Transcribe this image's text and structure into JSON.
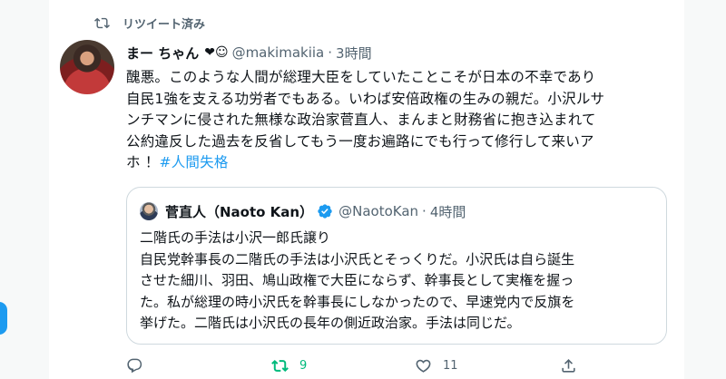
{
  "colors": {
    "accent": "#1d9bf0",
    "retweet_active": "#00ba7c",
    "muted_text": "#536471",
    "primary_text": "#0f1419",
    "border": "#cfd9de"
  },
  "social_context": {
    "icon": "retweet-icon",
    "label": "リツイート済み"
  },
  "tweet": {
    "author": {
      "display_name": "まー ちゃん",
      "name_emoji": "❤︎☺",
      "handle": "@makimakiia",
      "separator": "·",
      "time": "3時間"
    },
    "text_lines": [
      "醜悪。このような人間が総理大臣をしていたことこそが日本の不幸であり",
      "自民1強を支える功労者でもある。いわば安倍政権の生みの親だ。小沢ルサ",
      "ンチマンに侵された無様な政治家菅直人、まんまと財務省に抱き込まれて",
      "公約違反した過去を反省してもう一度お遍路にでも行って修行して来いア"
    ],
    "last_line_text": "ホ ！",
    "hashtag": "#人間失格"
  },
  "quoted_tweet": {
    "author": {
      "display_name": "菅直人（Naoto Kan）",
      "verified_icon": "verified-badge-icon",
      "handle": "@NaotoKan",
      "separator": "·",
      "time": "4時間"
    },
    "text_lines": [
      "二階氏の手法は小沢一郎氏譲り",
      "自民党幹事長の二階氏の手法は小沢氏とそっくりだ。小沢氏は自ら誕生",
      "させた細川、羽田、鳩山政権で大臣にならず、幹事長として実権を握っ",
      "た。私が総理の時小沢氏を幹事長にしなかったので、早速党内で反旗を",
      "挙げた。二階氏は小沢氏の長年の側近政治家。手法は同じだ。"
    ]
  },
  "actions": {
    "reply": {
      "icon": "reply-icon",
      "count": ""
    },
    "retweet": {
      "icon": "retweet-icon",
      "count": "9",
      "active": true
    },
    "like": {
      "icon": "heart-icon",
      "count": "11"
    },
    "share": {
      "icon": "share-icon",
      "count": ""
    }
  }
}
